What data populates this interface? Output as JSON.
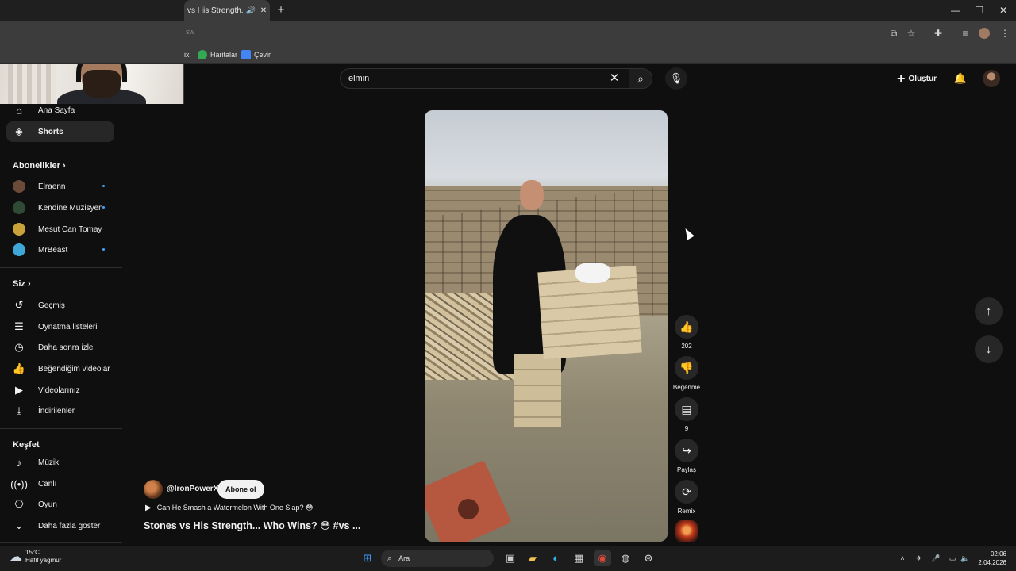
{
  "browser": {
    "tab_title": "vs His Strength... W",
    "tab_audio_icon": "speaker-icon",
    "url_fragment": "sw",
    "bookmarks": [
      {
        "label": "ix",
        "icon": "bookmark-icon"
      },
      {
        "label": "Haritalar",
        "icon": "maps-icon"
      },
      {
        "label": "Çevir",
        "icon": "translate-icon"
      }
    ]
  },
  "header": {
    "search_value": "elmin",
    "create_label": "Oluştur"
  },
  "sidebar": {
    "top_items": [
      {
        "label": "Ana Sayfa",
        "icon": "home-icon"
      },
      {
        "label": "Shorts",
        "icon": "shorts-icon",
        "active": true
      }
    ],
    "subscriptions_heading": "Abonelikler",
    "subscriptions": [
      {
        "label": "Elraenn",
        "avatar_color": "#6b4a3a"
      },
      {
        "label": "Kendine Müzisyen",
        "avatar_color": "#2f4a35"
      },
      {
        "label": "Mesut Can Tomay",
        "avatar_color": "#c9a23a"
      },
      {
        "label": "MrBeast",
        "avatar_color": "#3fa6d8"
      }
    ],
    "you_heading": "Siz",
    "you_items": [
      {
        "label": "Geçmiş",
        "icon": "history-icon"
      },
      {
        "label": "Oynatma listeleri",
        "icon": "playlist-icon"
      },
      {
        "label": "Daha sonra izle",
        "icon": "clock-icon"
      },
      {
        "label": "Beğendiğim videolar",
        "icon": "like-icon"
      },
      {
        "label": "Videolarınız",
        "icon": "video-icon"
      },
      {
        "label": "İndirilenler",
        "icon": "download-icon"
      }
    ],
    "explore_heading": "Keşfet",
    "explore_items": [
      {
        "label": "Müzik",
        "icon": "music-icon"
      },
      {
        "label": "Canlı",
        "icon": "live-icon"
      },
      {
        "label": "Oyun",
        "icon": "game-icon"
      },
      {
        "label": "Daha fazla göster",
        "icon": "chevron-down-icon"
      }
    ]
  },
  "short": {
    "channel": "@IronPowerX",
    "subscribe_label": "Abone ol",
    "music": "Can He Smash a Watermelon With One Slap? 😳",
    "title": "Stones vs His Strength... Who Wins? 😳 #vs ...",
    "actions": [
      {
        "label": "202",
        "icon": "like-icon"
      },
      {
        "label": "Beğenme",
        "icon": "dislike-icon"
      },
      {
        "label": "9",
        "icon": "comment-icon"
      },
      {
        "label": "Paylaş",
        "icon": "share-icon"
      },
      {
        "label": "Remix",
        "icon": "remix-icon"
      }
    ]
  },
  "taskbar": {
    "temperature": "15°C",
    "weather": "Hafif yağmur",
    "search_placeholder": "Ara",
    "time": "02:06",
    "date": "2.04.2026"
  }
}
